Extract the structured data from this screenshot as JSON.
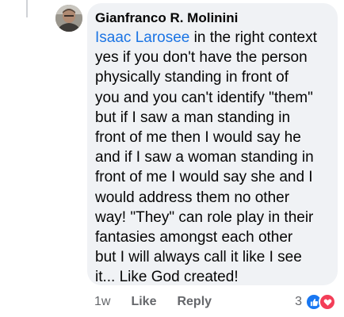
{
  "comment": {
    "author": "Gianfranco R. Molinini",
    "mention": "Isaac Larosee",
    "lines": [
      " in the right context",
      "yes if you don't have the person",
      "physically standing in front of",
      "you and you can't identify \"them\"",
      "but if I saw a man standing in",
      "front of me then I would say he",
      "and if I saw a woman standing in",
      "front of me I would say she and I",
      "would address them no other",
      "way! \"They\" can role play in their",
      "fantasies amongst each other",
      "but I will always call it like I see",
      "it... Like God created!"
    ]
  },
  "actions": {
    "time": "1w",
    "like_label": "Like",
    "reply_label": "Reply"
  },
  "reactions": {
    "count": "3",
    "types": [
      "like-icon",
      "love-icon"
    ],
    "like_color": "#1877f2",
    "love_color": "#f33e58"
  },
  "colors": {
    "bubble": "#f0f2f5",
    "mention": "#1b74e4",
    "meta": "#65676b"
  }
}
